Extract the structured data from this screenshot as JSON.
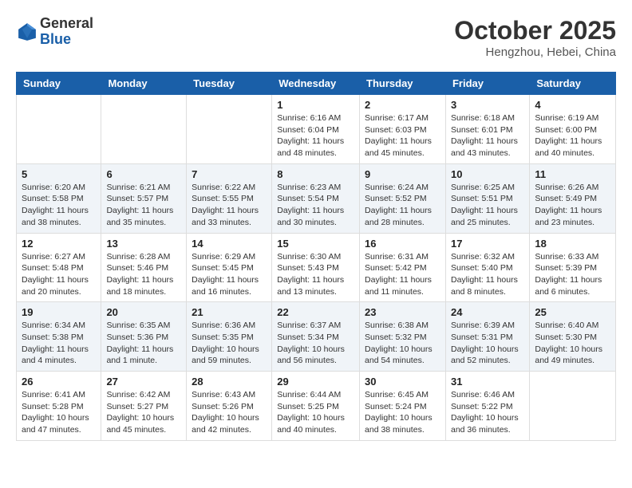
{
  "header": {
    "logo_general": "General",
    "logo_blue": "Blue",
    "month": "October 2025",
    "location": "Hengzhou, Hebei, China"
  },
  "weekdays": [
    "Sunday",
    "Monday",
    "Tuesday",
    "Wednesday",
    "Thursday",
    "Friday",
    "Saturday"
  ],
  "weeks": [
    [
      {
        "day": "",
        "info": ""
      },
      {
        "day": "",
        "info": ""
      },
      {
        "day": "",
        "info": ""
      },
      {
        "day": "1",
        "info": "Sunrise: 6:16 AM\nSunset: 6:04 PM\nDaylight: 11 hours\nand 48 minutes."
      },
      {
        "day": "2",
        "info": "Sunrise: 6:17 AM\nSunset: 6:03 PM\nDaylight: 11 hours\nand 45 minutes."
      },
      {
        "day": "3",
        "info": "Sunrise: 6:18 AM\nSunset: 6:01 PM\nDaylight: 11 hours\nand 43 minutes."
      },
      {
        "day": "4",
        "info": "Sunrise: 6:19 AM\nSunset: 6:00 PM\nDaylight: 11 hours\nand 40 minutes."
      }
    ],
    [
      {
        "day": "5",
        "info": "Sunrise: 6:20 AM\nSunset: 5:58 PM\nDaylight: 11 hours\nand 38 minutes."
      },
      {
        "day": "6",
        "info": "Sunrise: 6:21 AM\nSunset: 5:57 PM\nDaylight: 11 hours\nand 35 minutes."
      },
      {
        "day": "7",
        "info": "Sunrise: 6:22 AM\nSunset: 5:55 PM\nDaylight: 11 hours\nand 33 minutes."
      },
      {
        "day": "8",
        "info": "Sunrise: 6:23 AM\nSunset: 5:54 PM\nDaylight: 11 hours\nand 30 minutes."
      },
      {
        "day": "9",
        "info": "Sunrise: 6:24 AM\nSunset: 5:52 PM\nDaylight: 11 hours\nand 28 minutes."
      },
      {
        "day": "10",
        "info": "Sunrise: 6:25 AM\nSunset: 5:51 PM\nDaylight: 11 hours\nand 25 minutes."
      },
      {
        "day": "11",
        "info": "Sunrise: 6:26 AM\nSunset: 5:49 PM\nDaylight: 11 hours\nand 23 minutes."
      }
    ],
    [
      {
        "day": "12",
        "info": "Sunrise: 6:27 AM\nSunset: 5:48 PM\nDaylight: 11 hours\nand 20 minutes."
      },
      {
        "day": "13",
        "info": "Sunrise: 6:28 AM\nSunset: 5:46 PM\nDaylight: 11 hours\nand 18 minutes."
      },
      {
        "day": "14",
        "info": "Sunrise: 6:29 AM\nSunset: 5:45 PM\nDaylight: 11 hours\nand 16 minutes."
      },
      {
        "day": "15",
        "info": "Sunrise: 6:30 AM\nSunset: 5:43 PM\nDaylight: 11 hours\nand 13 minutes."
      },
      {
        "day": "16",
        "info": "Sunrise: 6:31 AM\nSunset: 5:42 PM\nDaylight: 11 hours\nand 11 minutes."
      },
      {
        "day": "17",
        "info": "Sunrise: 6:32 AM\nSunset: 5:40 PM\nDaylight: 11 hours\nand 8 minutes."
      },
      {
        "day": "18",
        "info": "Sunrise: 6:33 AM\nSunset: 5:39 PM\nDaylight: 11 hours\nand 6 minutes."
      }
    ],
    [
      {
        "day": "19",
        "info": "Sunrise: 6:34 AM\nSunset: 5:38 PM\nDaylight: 11 hours\nand 4 minutes."
      },
      {
        "day": "20",
        "info": "Sunrise: 6:35 AM\nSunset: 5:36 PM\nDaylight: 11 hours\nand 1 minute."
      },
      {
        "day": "21",
        "info": "Sunrise: 6:36 AM\nSunset: 5:35 PM\nDaylight: 10 hours\nand 59 minutes."
      },
      {
        "day": "22",
        "info": "Sunrise: 6:37 AM\nSunset: 5:34 PM\nDaylight: 10 hours\nand 56 minutes."
      },
      {
        "day": "23",
        "info": "Sunrise: 6:38 AM\nSunset: 5:32 PM\nDaylight: 10 hours\nand 54 minutes."
      },
      {
        "day": "24",
        "info": "Sunrise: 6:39 AM\nSunset: 5:31 PM\nDaylight: 10 hours\nand 52 minutes."
      },
      {
        "day": "25",
        "info": "Sunrise: 6:40 AM\nSunset: 5:30 PM\nDaylight: 10 hours\nand 49 minutes."
      }
    ],
    [
      {
        "day": "26",
        "info": "Sunrise: 6:41 AM\nSunset: 5:28 PM\nDaylight: 10 hours\nand 47 minutes."
      },
      {
        "day": "27",
        "info": "Sunrise: 6:42 AM\nSunset: 5:27 PM\nDaylight: 10 hours\nand 45 minutes."
      },
      {
        "day": "28",
        "info": "Sunrise: 6:43 AM\nSunset: 5:26 PM\nDaylight: 10 hours\nand 42 minutes."
      },
      {
        "day": "29",
        "info": "Sunrise: 6:44 AM\nSunset: 5:25 PM\nDaylight: 10 hours\nand 40 minutes."
      },
      {
        "day": "30",
        "info": "Sunrise: 6:45 AM\nSunset: 5:24 PM\nDaylight: 10 hours\nand 38 minutes."
      },
      {
        "day": "31",
        "info": "Sunrise: 6:46 AM\nSunset: 5:22 PM\nDaylight: 10 hours\nand 36 minutes."
      },
      {
        "day": "",
        "info": ""
      }
    ]
  ]
}
